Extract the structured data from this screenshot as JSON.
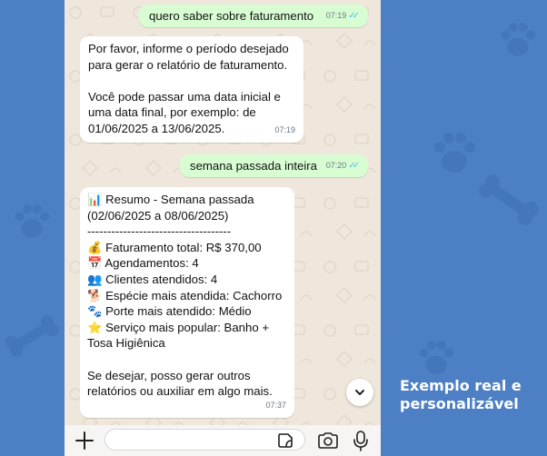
{
  "caption": {
    "line1": "Exemplo real e",
    "line2": "personalizável"
  },
  "chat": {
    "messages": [
      {
        "direction": "outgoing",
        "text": "quero saber sobre faturamento",
        "time": "07:19",
        "read": true
      },
      {
        "direction": "incoming",
        "text": "Por favor, informe o período desejado\npara gerar o relatório de faturamento.\n\nVocê pode passar uma data inicial e\numa data final, por exemplo: de\n01/06/2025 a 13/06/2025.",
        "time": "07:19"
      },
      {
        "direction": "outgoing",
        "text": "semana passada inteira",
        "time": "07:20",
        "read": true
      },
      {
        "direction": "incoming",
        "text": "📊 Resumo - Semana passada\n(02/06/2025 a 08/06/2025)\n------------------------------------\n💰 Faturamento total: R$ 370,00\n📅 Agendamentos: 4\n👥 Clientes atendidos: 4\n🐕 Espécie mais atendida: Cachorro\n🐾 Porte mais atendido: Médio\n⭐ Serviço mais popular: Banho +\nTosa Higiênica\n\nSe desejar, posso gerar outros\nrelatórios ou auxiliar em algo mais.",
        "time": "07:37"
      }
    ]
  },
  "input": {
    "placeholder": ""
  },
  "icons": {
    "attach": "plus-icon",
    "sticker": "sticker-icon",
    "camera": "camera-icon",
    "mic": "microphone-icon",
    "scroll": "chevron-down-icon",
    "read_receipt": "double-check-icon"
  },
  "colors": {
    "background": "#4d7fc4",
    "chat_background": "#efe7dc",
    "outgoing_bubble": "#d9fdd3",
    "incoming_bubble": "#ffffff",
    "read_ticks": "#53bdeb"
  }
}
